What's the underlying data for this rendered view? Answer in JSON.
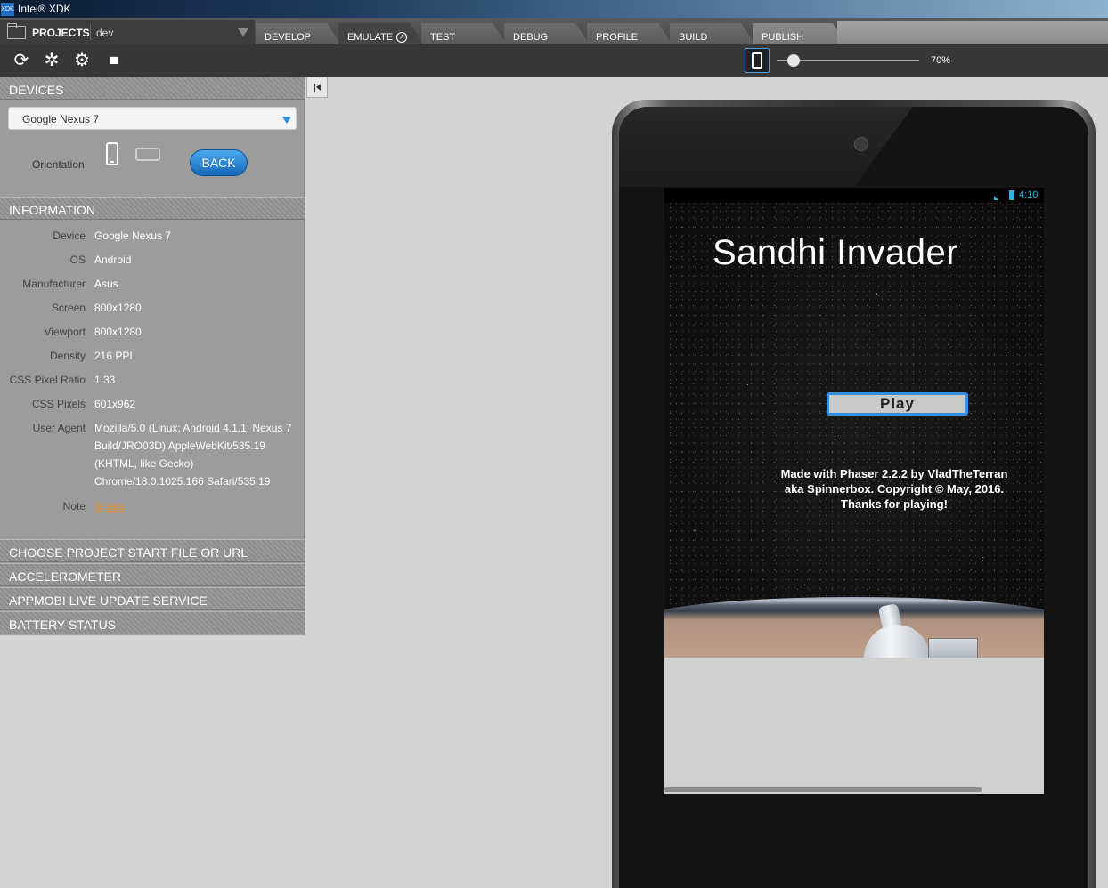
{
  "app": {
    "title": "Intel® XDK",
    "logo_text": "XDK"
  },
  "projects": {
    "label": "PROJECTS",
    "current": "dev"
  },
  "tabs": [
    {
      "label": "DEVELOP"
    },
    {
      "label": "EMULATE",
      "active": true
    },
    {
      "label": "TEST"
    },
    {
      "label": "DEBUG"
    },
    {
      "label": "PROFILE"
    },
    {
      "label": "BUILD"
    },
    {
      "label": "PUBLISH"
    }
  ],
  "toolbar": {
    "icons": [
      "reload-icon",
      "debug-bug-icon",
      "settings-gear-icon",
      "stop-icon"
    ],
    "zoom_label": "70%",
    "zoom_fraction": 0.1
  },
  "devices": {
    "header": "DEVICES",
    "selected": "Google Nexus 7",
    "orientation_label": "Orientation",
    "back_label": "BACK"
  },
  "information": {
    "header": "INFORMATION",
    "rows": [
      {
        "key": "Device",
        "value": "Google Nexus 7"
      },
      {
        "key": "OS",
        "value": "Android"
      },
      {
        "key": "Manufacturer",
        "value": "Asus"
      },
      {
        "key": "Screen",
        "value": "800x1280"
      },
      {
        "key": "Viewport",
        "value": "800x1280"
      },
      {
        "key": "Density",
        "value": "216 PPI"
      },
      {
        "key": "CSS Pixel Ratio",
        "value": "1.33"
      },
      {
        "key": "CSS Pixels",
        "value": "601x962"
      }
    ],
    "user_agent_key": "User Agent",
    "user_agent_lines": [
      "Mozilla/5.0 (Linux; Android 4.1.1; Nexus 7",
      "Build/JRO03D) AppleWebKit/535.19",
      "(KHTML, like Gecko)",
      "Chrome/18.0.1025.166 Safari/535.19"
    ],
    "note_key": "Note",
    "note_link": "Specs"
  },
  "sections": [
    "CHOOSE PROJECT START FILE OR URL",
    "ACCELEROMETER",
    "APPMOBI LIVE UPDATE SERVICE",
    "BATTERY STATUS"
  ],
  "emulator": {
    "status_time": "4:10",
    "game_title": "Sandhi Invader",
    "play_label": "Play",
    "credits": "Made with Phaser 2.2.2 by VladTheTerran aka Spinnerbox. Copyright © May, 2016. Thanks for playing!"
  },
  "colors": {
    "accent": "#2d8bd6",
    "link": "#f08a1c",
    "status": "#33b5e5"
  }
}
